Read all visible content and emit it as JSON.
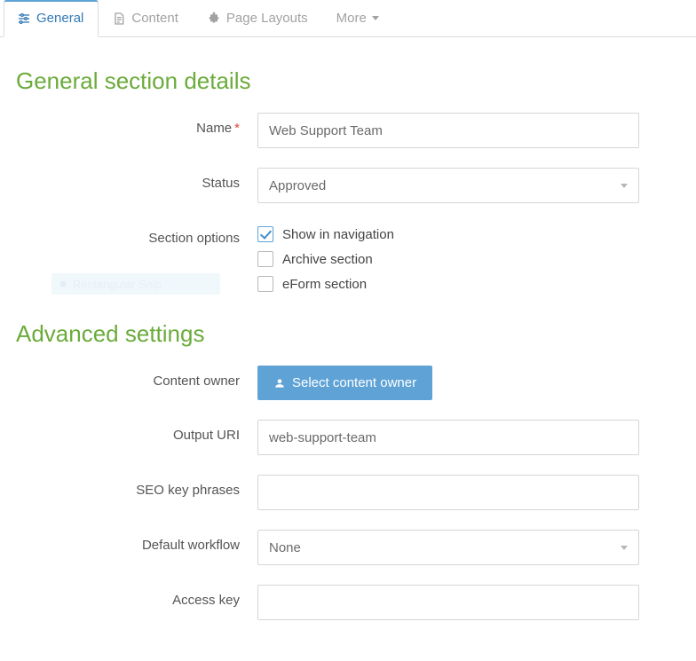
{
  "tabs": {
    "general": "General",
    "content": "Content",
    "page_layouts": "Page Layouts",
    "more": "More"
  },
  "general_section": {
    "title": "General section details",
    "name_label": "Name",
    "name_value": "Web Support Team",
    "status_label": "Status",
    "status_value": "Approved",
    "section_options_label": "Section options",
    "options": {
      "show_in_navigation": {
        "label": "Show in navigation",
        "checked": true
      },
      "archive_section": {
        "label": "Archive section",
        "checked": false
      },
      "eform_section": {
        "label": "eForm section",
        "checked": false
      }
    }
  },
  "advanced": {
    "title": "Advanced settings",
    "content_owner_label": "Content owner",
    "select_content_owner_btn": "Select content owner",
    "output_uri_label": "Output URI",
    "output_uri_value": "web-support-team",
    "seo_label": "SEO key phrases",
    "seo_value": "",
    "default_workflow_label": "Default workflow",
    "default_workflow_value": "None",
    "access_key_label": "Access key",
    "access_key_value": ""
  },
  "snip_hint": "Rectangular Snip"
}
